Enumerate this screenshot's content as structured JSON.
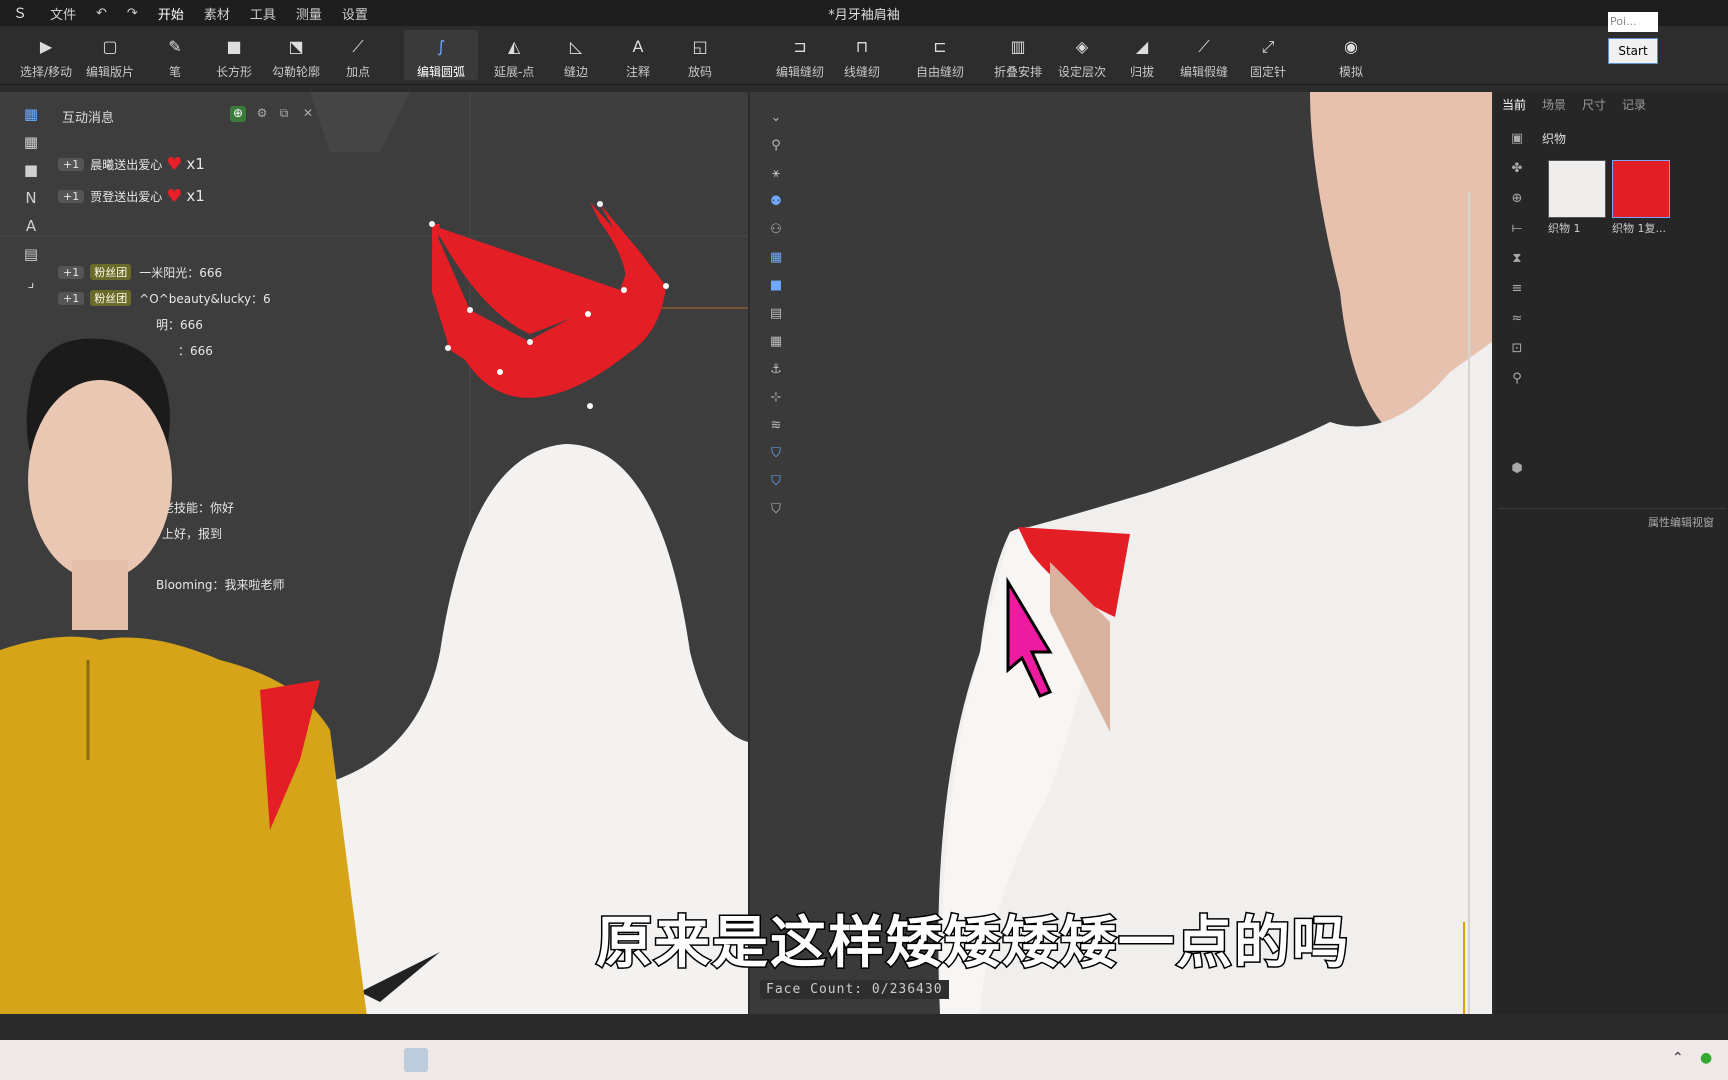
{
  "app": {
    "title": "*月牙袖肩袖"
  },
  "menu": [
    "文件",
    "开始",
    "素材",
    "工具",
    "测量",
    "设置"
  ],
  "toolbar": [
    {
      "label": "选择/移动",
      "icon": "cursor-icon"
    },
    {
      "label": "编辑版片",
      "icon": "edit-pattern-icon"
    },
    {
      "label": "笔",
      "icon": "pen-icon"
    },
    {
      "label": "长方形",
      "icon": "rectangle-icon"
    },
    {
      "label": "勾勒轮廓",
      "icon": "trace-icon"
    },
    {
      "label": "加点",
      "icon": "add-point-icon"
    },
    {
      "label": "编辑圆弧",
      "icon": "edit-arc-icon"
    },
    {
      "label": "延展-点",
      "icon": "extend-point-icon"
    },
    {
      "label": "缝边",
      "icon": "seam-allowance-icon"
    },
    {
      "label": "注释",
      "icon": "annotation-icon"
    },
    {
      "label": "放码",
      "icon": "grading-icon"
    },
    {
      "label": "编辑缝纫",
      "icon": "edit-sewing-icon"
    },
    {
      "label": "线缝纫",
      "icon": "line-sewing-icon"
    },
    {
      "label": "自由缝纫",
      "icon": "free-sewing-icon"
    },
    {
      "label": "折叠安排",
      "icon": "fold-arrange-icon"
    },
    {
      "label": "设定层次",
      "icon": "layer-icon"
    },
    {
      "label": "归拔",
      "icon": "shrink-icon"
    },
    {
      "label": "编辑假缝",
      "icon": "tack-icon"
    },
    {
      "label": "固定针",
      "icon": "pin-icon"
    },
    {
      "label": "模拟",
      "icon": "simulate-icon"
    }
  ],
  "start_button": "Start",
  "poi_text": "Poi...",
  "chat": {
    "title": "互动消息",
    "lines": [
      {
        "plus": "+1",
        "text": "晨曦送出爱心",
        "suffix": "x1"
      },
      {
        "plus": "+1",
        "text": "贾登送出爱心",
        "suffix": "x1"
      },
      {
        "plus": "+1",
        "badge": "粉丝团",
        "text": "一米阳光：666"
      },
      {
        "plus": "+1",
        "badge": "粉丝团",
        "text": "^O^beauty&lucky：6"
      },
      {
        "text": "明：666"
      },
      {
        "text": "：666"
      },
      {
        "text": "老技能：你好"
      },
      {
        "text": "上好，报到"
      },
      {
        "text": "Blooming：我来啦老师"
      }
    ]
  },
  "right_panel": {
    "tabs": [
      "当前",
      "场景",
      "尺寸",
      "记录"
    ],
    "section": "织物",
    "swatches": [
      {
        "label": "织物 1",
        "color": "#efeeec"
      },
      {
        "label": "织物 1复...",
        "color": "#e41e25"
      }
    ],
    "prop_view": "属性编辑视窗"
  },
  "face_count": "Face Count: 0/236430",
  "subtitle": "原来是这样矮矮矮矮一点的吗",
  "colors": {
    "accent_red": "#e41e25",
    "fabric_white": "#efeeec",
    "cursor_magenta": "#ec1ba0"
  }
}
